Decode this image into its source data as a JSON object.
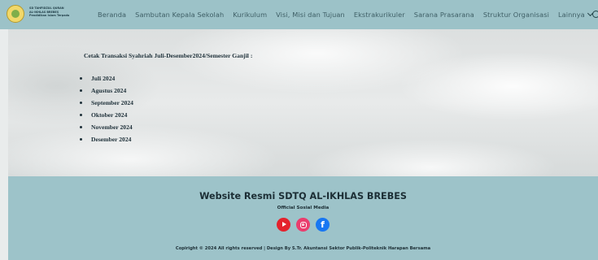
{
  "nav": {
    "logo_lines": [
      "SD TAHFIDZUL QURAN",
      "AL-IKHLAS BREBES",
      "Pendidikan Islam Terpadu"
    ],
    "links": [
      "Beranda",
      "Sambutan Kepala Sekolah",
      "Kurikulum",
      "Visi, Misi dan Tujuan",
      "Ekstrakurikuler",
      "Sarana Prasarana",
      "Struktur Organisasi",
      "Lainnya"
    ],
    "more_icon": "chevron-down-icon",
    "search_icon": "search-icon"
  },
  "content": {
    "heading": "Cetak Transaksi Syahriah  Juli-Desember2024/Semester Ganjil :",
    "months": [
      "Juli 2024",
      "Agustus 2024",
      "September 2024",
      "Oktober 2024",
      "November 2024",
      "Desember 2024"
    ]
  },
  "footer": {
    "title": "Website Resmi SDTQ AL-IKHLAS BREBES",
    "subtitle": "Official Sosial Media",
    "social_icons": [
      "youtube-icon",
      "instagram-icon",
      "facebook-icon"
    ],
    "copyright": "Copiright © 2024  All rights reserved | Design By S.Tr. Akuntansi Sektor Publik-Politeknik Harapan Bersama"
  },
  "colors": {
    "nav_bg": "#9cc2c8",
    "footer_bg": "#9dc3c9",
    "text_dark": "#1c2e35",
    "youtube": "#e4222d",
    "instagram": "#ea3d6d",
    "facebook": "#1877f2"
  }
}
